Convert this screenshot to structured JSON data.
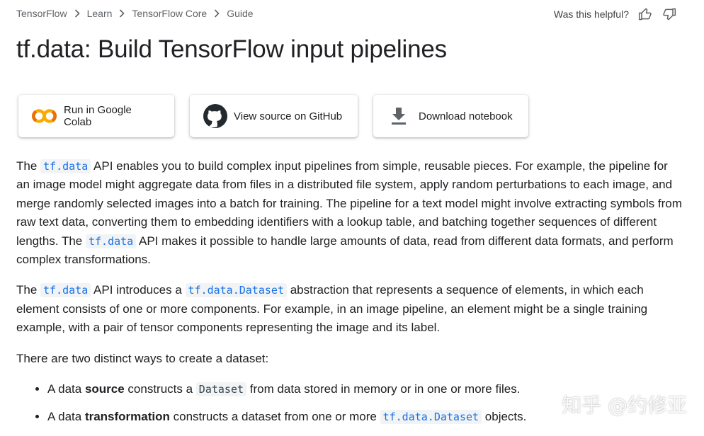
{
  "breadcrumb": [
    "TensorFlow",
    "Learn",
    "TensorFlow Core",
    "Guide"
  ],
  "helpful": {
    "label": "Was this helpful?"
  },
  "title": "tf.data: Build TensorFlow input pipelines",
  "buttons": {
    "colab": "Run in Google Colab",
    "github": "View source on GitHub",
    "download": "Download notebook"
  },
  "para1": {
    "t1": "The ",
    "c1": "tf.data",
    "t2": " API enables you to build complex input pipelines from simple, reusable pieces. For example, the pipeline for an image model might aggregate data from files in a distributed file system, apply random perturbations to each image, and merge randomly selected images into a batch for training. The pipeline for a text model might involve extracting symbols from raw text data, converting them to embedding identifiers with a lookup table, and batching together sequences of different lengths. The ",
    "c2": "tf.data",
    "t3": " API makes it possible to handle large amounts of data, read from different data formats, and perform complex transformations."
  },
  "para2": {
    "t1": "The ",
    "c1": "tf.data",
    "t2": " API introduces a ",
    "c2": "tf.data.Dataset",
    "t3": " abstraction that represents a sequence of elements, in which each element consists of one or more components. For example, in an image pipeline, an element might be a single training example, with a pair of tensor components representing the image and its label."
  },
  "para3": "There are two distinct ways to create a dataset:",
  "bullets": {
    "b1": {
      "t1": "A data ",
      "bold": "source",
      "t2": " constructs a ",
      "code": "Dataset",
      "t3": " from data stored in memory or in one or more files."
    },
    "b2": {
      "t1": "A data ",
      "bold": "transformation",
      "t2": " constructs a dataset from one or more ",
      "code": "tf.data.Dataset",
      "t3": " objects."
    }
  },
  "watermark": "知乎 @约修亚",
  "colors": {
    "link": "#1a73e8",
    "text": "#202124",
    "muted": "#5f6368",
    "code_bg": "#f1f3f4"
  }
}
